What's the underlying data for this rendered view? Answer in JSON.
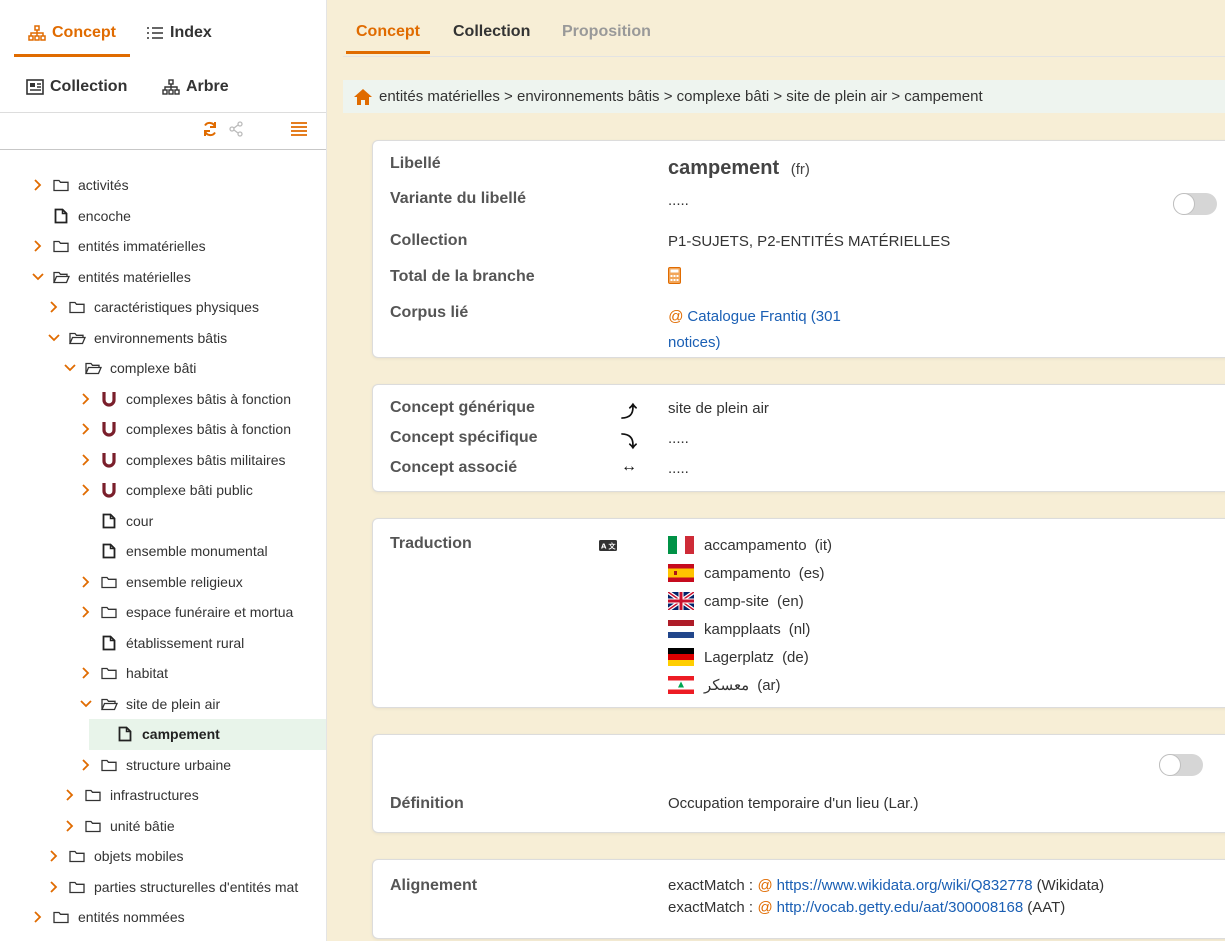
{
  "sidebar": {
    "tabs": [
      {
        "label": "Concept",
        "icon": "sitemap-icon",
        "active": true
      },
      {
        "label": "Index",
        "icon": "list-icon",
        "active": false
      }
    ],
    "subtabs": [
      {
        "label": "Collection",
        "icon": "collection-icon"
      },
      {
        "label": "Arbre",
        "icon": "sitemap-icon"
      }
    ],
    "tree": [
      {
        "label": "activités",
        "level": 0,
        "type": "folder",
        "expanded": false
      },
      {
        "label": "encoche",
        "level": 0,
        "type": "leaf"
      },
      {
        "label": "entités immatérielles",
        "level": 0,
        "type": "folder",
        "expanded": false
      },
      {
        "label": "entités matérielles",
        "level": 0,
        "type": "folder",
        "expanded": true
      },
      {
        "label": "caractéristiques physiques",
        "level": 1,
        "type": "folder",
        "expanded": false
      },
      {
        "label": "environnements bâtis",
        "level": 1,
        "type": "folder",
        "expanded": true
      },
      {
        "label": "complexe bâti",
        "level": 2,
        "type": "folder",
        "expanded": true
      },
      {
        "label": "complexes bâtis à fonction",
        "level": 3,
        "type": "group"
      },
      {
        "label": "complexes bâtis à fonction",
        "level": 3,
        "type": "group"
      },
      {
        "label": "complexes bâtis militaires",
        "level": 3,
        "type": "group"
      },
      {
        "label": "complexe bâti public",
        "level": 3,
        "type": "group"
      },
      {
        "label": "cour",
        "level": 3,
        "type": "leaf"
      },
      {
        "label": "ensemble monumental",
        "level": 3,
        "type": "leaf"
      },
      {
        "label": "ensemble religieux",
        "level": 3,
        "type": "folder",
        "expanded": false
      },
      {
        "label": "espace funéraire et mortua",
        "level": 3,
        "type": "folder",
        "expanded": false
      },
      {
        "label": "établissement rural",
        "level": 3,
        "type": "leaf"
      },
      {
        "label": "habitat",
        "level": 3,
        "type": "folder",
        "expanded": false
      },
      {
        "label": "site de plein air",
        "level": 3,
        "type": "folder",
        "expanded": true
      },
      {
        "label": "campement",
        "level": 4,
        "type": "leaf",
        "selected": true
      },
      {
        "label": "structure urbaine",
        "level": 3,
        "type": "folder",
        "expanded": false
      },
      {
        "label": "infrastructures",
        "level": 2,
        "type": "folder",
        "expanded": false
      },
      {
        "label": "unité bâtie",
        "level": 2,
        "type": "folder",
        "expanded": false
      },
      {
        "label": "objets mobiles",
        "level": 1,
        "type": "folder",
        "expanded": false
      },
      {
        "label": "parties structurelles d'entités mat",
        "level": 1,
        "type": "folder",
        "expanded": false
      },
      {
        "label": "entités nommées",
        "level": 0,
        "type": "folder",
        "expanded": false
      }
    ]
  },
  "main": {
    "tabs": [
      {
        "label": "Concept",
        "state": "active"
      },
      {
        "label": "Collection",
        "state": "normal"
      },
      {
        "label": "Proposition",
        "state": "disabled"
      }
    ],
    "breadcrumb": "entités matérielles > environnements bâtis > complexe bâti > site de plein air > campement",
    "info": {
      "libelle_label": "Libellé",
      "libelle_value": "campement",
      "libelle_lang": "(fr)",
      "variante_label": "Variante du libellé",
      "variante_value": ".....",
      "collection_label": "Collection",
      "collection_value": "P1-SUJETS, P2-ENTITÉS MATÉRIELLES",
      "total_label": "Total de la branche",
      "corpus_label": "Corpus lié",
      "corpus_value_line1": "Catalogue Frantiq (301",
      "corpus_value_line2": "notices)"
    },
    "relations": [
      {
        "label": "Concept générique",
        "icon": "arrow-up-icon",
        "glyph": "⤴",
        "value": "site de plein air"
      },
      {
        "label": "Concept spécifique",
        "icon": "arrow-down-icon",
        "glyph": "⤵",
        "value": "....."
      },
      {
        "label": "Concept associé",
        "icon": "arrow-both-icon",
        "glyph": "↔",
        "value": "....."
      }
    ],
    "traduction": {
      "label": "Traduction",
      "items": [
        {
          "text": "accampamento",
          "lang": "(it)",
          "flag": "it"
        },
        {
          "text": "campamento",
          "lang": "(es)",
          "flag": "es"
        },
        {
          "text": "camp-site",
          "lang": "(en)",
          "flag": "uk"
        },
        {
          "text": "kampplaats",
          "lang": "(nl)",
          "flag": "nl"
        },
        {
          "text": "Lagerplatz",
          "lang": "(de)",
          "flag": "de"
        },
        {
          "text": "معسكر",
          "lang": "(ar)",
          "flag": "lb"
        }
      ]
    },
    "definition": {
      "label": "Définition",
      "value": "Occupation temporaire d'un lieu (Lar.)"
    },
    "alignement": {
      "label": "Alignement",
      "items": [
        {
          "prefix": "exactMatch :",
          "url": "https://www.wikidata.org/wiki/Q832778",
          "source": "(Wikidata)"
        },
        {
          "prefix": "exactMatch :",
          "url": "http://vocab.getty.edu/aat/300008168",
          "source": "(AAT)"
        }
      ]
    }
  },
  "colors": {
    "accent": "#e06b00",
    "link": "#1a5fb4",
    "selected_bg": "#e8f4ea",
    "breadcrumb_bg": "#eef4ef"
  }
}
